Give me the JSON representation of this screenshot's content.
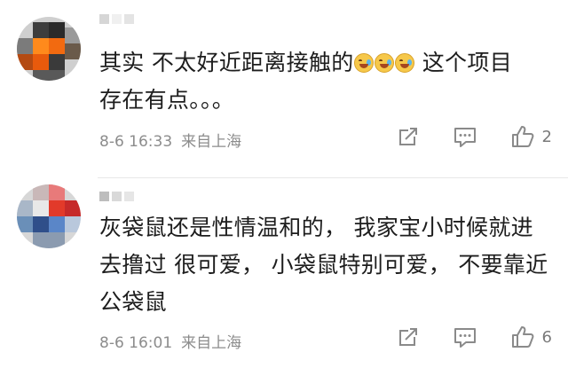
{
  "comments": [
    {
      "text_line1_a": "其实 不太好近距离接触的",
      "text_line1_b": " 这个项目",
      "text_line2": "存在有点。。。",
      "emojis": [
        "laugh-cry-emoji",
        "laugh-cry-emoji",
        "laugh-cry-emoji"
      ],
      "date": "8-6 16:33",
      "location": "来自上海",
      "likes": "2"
    },
    {
      "text": "灰袋鼠还是性情温和的， 我家宝小时候就进去撸过 很可爱， 小袋鼠特别可爱， 不要靠近公袋鼠",
      "date": "8-6 16:01",
      "location": "来自上海",
      "likes": "6"
    }
  ],
  "icons": {
    "share": "share-icon",
    "reply": "comment-icon",
    "like": "thumbs-up-icon"
  },
  "colors": {
    "text": "#1d1d1d",
    "meta": "#8c8c8c",
    "icon": "#8a8a8a",
    "divider": "#e8e8e8"
  }
}
